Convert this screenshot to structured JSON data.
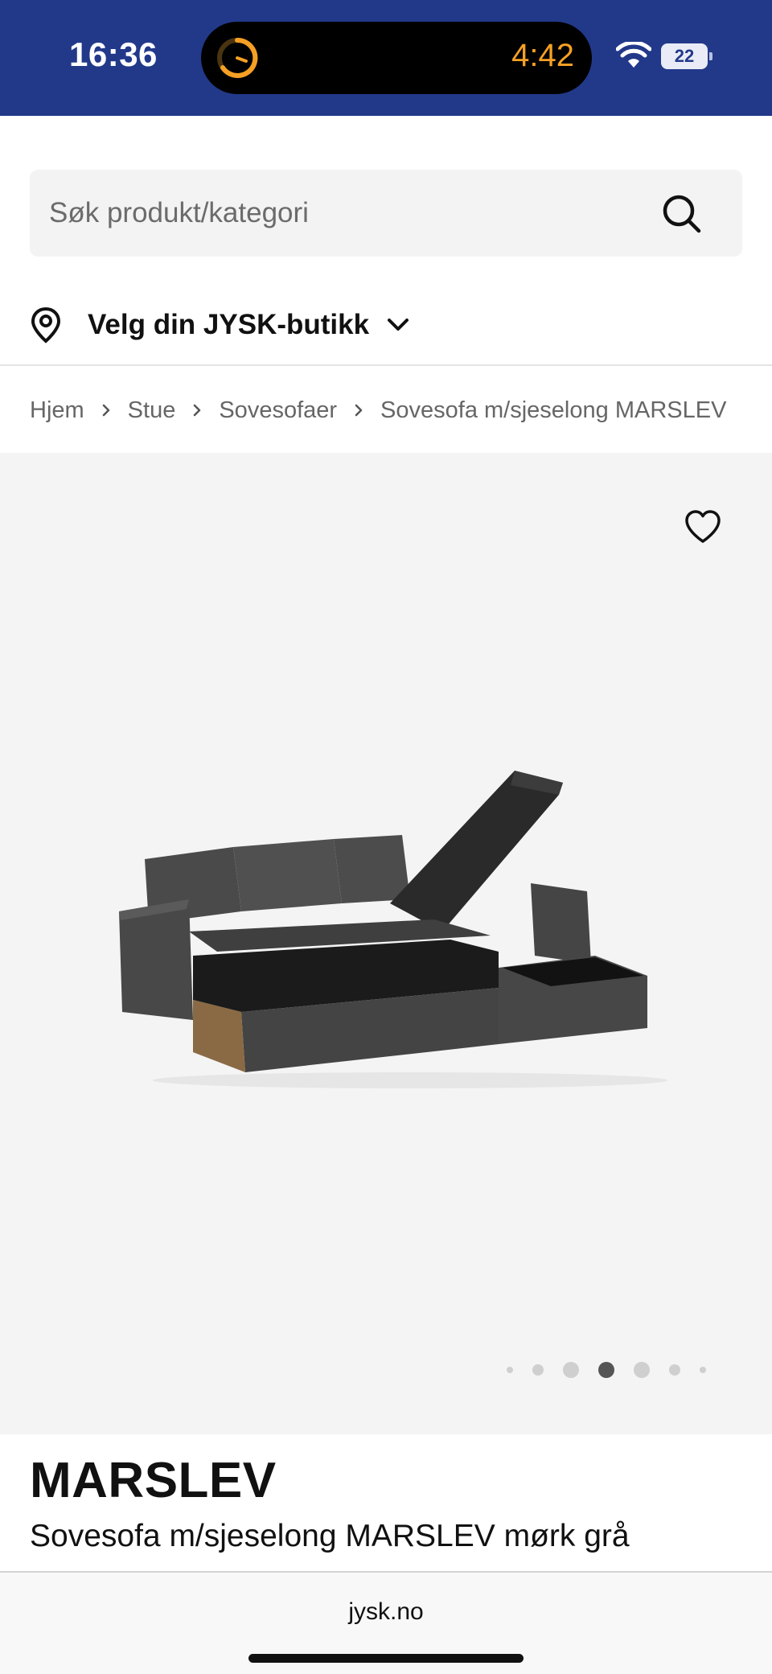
{
  "status_bar": {
    "time": "16:36",
    "timer": "4:42",
    "battery": "22",
    "icons": [
      "timer-ring-icon",
      "wifi-icon",
      "battery-icon"
    ],
    "colors": {
      "background": "#22398a",
      "timer": "#f5a024"
    }
  },
  "search": {
    "placeholder": "Søk produkt/kategori",
    "value": "",
    "icon": "search-icon"
  },
  "store": {
    "label": "Velg din JYSK-butikk",
    "icons": [
      "location-pin-icon",
      "chevron-down-icon"
    ]
  },
  "breadcrumb": {
    "items": [
      "Hjem",
      "Stue",
      "Sovesofaer",
      "Sovesofa m/sjeselong MARSLEV"
    ]
  },
  "gallery": {
    "favorite_icon": "heart-icon",
    "image": "dark grey corner sofa bed with open storage",
    "slide_count": 7,
    "active_slide": 4,
    "colors": {
      "background": "#f4f4f4",
      "active_dot": "#555555"
    }
  },
  "product": {
    "name": "MARSLEV",
    "description": "Sovesofa m/sjeselong MARSLEV mørk grå"
  },
  "browser": {
    "url": "jysk.no"
  }
}
